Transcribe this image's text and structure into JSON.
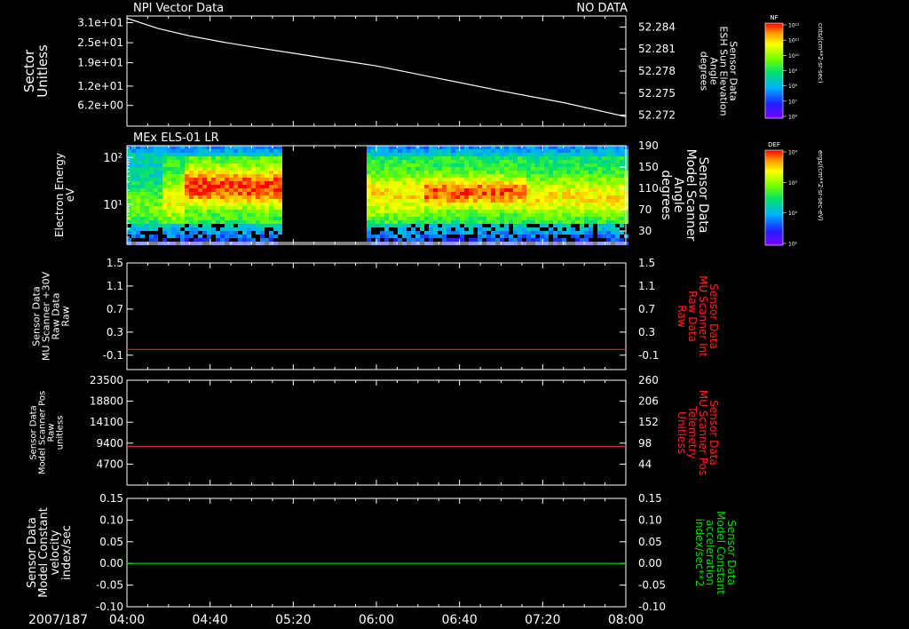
{
  "header": {
    "top_title": "NPI Vector Data",
    "top_status": "NO DATA",
    "panel2_title": "MEx ELS-01 LR"
  },
  "colors": {
    "background": "#000000",
    "axis": "#ffffff",
    "red_trace": "#ff2020",
    "green_trace": "#00dd00"
  },
  "x_axis": {
    "date_label": "2007/187",
    "ticks": [
      "04:00",
      "04:40",
      "05:20",
      "06:00",
      "06:40",
      "07:20",
      "08:00"
    ],
    "range_hours": [
      4.0,
      8.0
    ]
  },
  "colorbars": [
    {
      "name": "NF",
      "unit": "cnts/(cm**2-sr-sec)",
      "tick_labels": [
        "10¹²",
        "10¹¹",
        "10¹⁰",
        "10⁹",
        "10⁸",
        "10⁷",
        "10⁶"
      ]
    },
    {
      "name": "DEF",
      "unit": "ergs/(cm**2-sr-sec-eV)",
      "tick_labels": [
        "10⁴",
        "10³",
        "10²",
        "10¹"
      ]
    }
  ],
  "chart_data": [
    {
      "type": "line",
      "left_axis": {
        "label_lines": [
          "Sector",
          "Unitless"
        ],
        "ticks": [
          "3.1e+01",
          "2.5e+01",
          "1.9e+01",
          "1.2e+01",
          "6.2e+00"
        ],
        "tick_values": [
          31,
          25,
          19,
          12,
          6.2
        ],
        "range": [
          0,
          33
        ]
      },
      "right_axis": {
        "label_lines": [
          "Sensor Data",
          "ESH Sun Elevation",
          "Angle",
          "degrees"
        ],
        "ticks": [
          "52.284",
          "52.281",
          "52.278",
          "52.275",
          "52.272"
        ],
        "tick_values": [
          52.284,
          52.281,
          52.278,
          52.275,
          52.272
        ],
        "range": [
          52.2705,
          52.2855
        ]
      },
      "series": [
        {
          "axis": "right",
          "color": "#ffffff",
          "x": [
            4.0,
            4.25,
            4.5,
            4.75,
            5.0,
            5.5,
            6.0,
            6.5,
            7.0,
            7.5,
            8.0
          ],
          "y": [
            52.2852,
            52.2838,
            52.2828,
            52.282,
            52.2813,
            52.28,
            52.2787,
            52.277,
            52.2753,
            52.2737,
            52.2718
          ]
        }
      ]
    },
    {
      "type": "heatmap",
      "left_axis": {
        "label_lines": [
          "Electron Energy",
          "eV"
        ],
        "ticks": [
          "10²",
          "10¹"
        ],
        "log_range": [
          0.15,
          2.25
        ],
        "tick_log": [
          2,
          1
        ]
      },
      "right_axis": {
        "label_lines": [
          "Sensor Data",
          "Model Scanner",
          "Angle",
          "degrees"
        ],
        "ticks": [
          "190",
          "150",
          "110",
          "70",
          "30"
        ],
        "tick_values": [
          190,
          150,
          110,
          70,
          30
        ],
        "range": [
          5,
          190
        ]
      },
      "data_gap_hours": [
        5.25,
        5.91
      ],
      "angle_trace": {
        "color": "#ffffff",
        "x": [
          4.0,
          5.25,
          5.91,
          8.0
        ],
        "y": [
          5,
          5,
          5,
          5
        ]
      }
    },
    {
      "type": "line",
      "left_axis": {
        "label_lines": [
          "Sensor Data",
          "MU Scanner +30V",
          "Raw Data",
          "Raw"
        ],
        "ticks": [
          "1.5",
          "1.1",
          "0.7",
          "0.3",
          "-0.1"
        ],
        "tick_values": [
          1.5,
          1.1,
          0.7,
          0.3,
          -0.1
        ],
        "range": [
          -0.35,
          1.5
        ]
      },
      "right_axis": {
        "label_lines": [
          "Sensor Data",
          "MU Scanner Int",
          "Raw Data",
          "Raw"
        ],
        "ticks": [
          "1.5",
          "1.1",
          "0.7",
          "0.3",
          "-0.1"
        ],
        "tick_values": [
          1.5,
          1.1,
          0.7,
          0.3,
          -0.1
        ],
        "range": [
          -0.35,
          1.5
        ]
      },
      "series": [
        {
          "axis": "left",
          "color": "#ff2020",
          "x": [
            4.0,
            8.0
          ],
          "y": [
            0.0,
            0.0
          ]
        }
      ]
    },
    {
      "type": "line",
      "left_axis": {
        "label_lines": [
          "Sensor Data",
          "Model Scanner Pos",
          "Raw",
          "unitless"
        ],
        "ticks": [
          "23500",
          "18800",
          "14100",
          "9400",
          "4700"
        ],
        "tick_values": [
          23500,
          18800,
          14100,
          9400,
          4700
        ],
        "range": [
          0,
          23500
        ]
      },
      "right_axis": {
        "label_lines": [
          "Sensor Data",
          "MU Scanner Pos",
          "Telemetry",
          "Unitless"
        ],
        "ticks": [
          "260",
          "206",
          "152",
          "98",
          "44"
        ],
        "tick_values": [
          260,
          206,
          152,
          98,
          44
        ],
        "range": [
          -10,
          260
        ]
      },
      "series": [
        {
          "axis": "left",
          "color": "#ff2020",
          "x": [
            4.0,
            8.0
          ],
          "y": [
            8700,
            8700
          ]
        }
      ]
    },
    {
      "type": "line",
      "left_axis": {
        "label_lines": [
          "Sensor Data",
          "Model Constant",
          "velocity",
          "index/sec"
        ],
        "ticks": [
          "0.15",
          "0.10",
          "0.05",
          "0.00",
          "-0.05",
          "-0.10"
        ],
        "tick_values": [
          0.15,
          0.1,
          0.05,
          0.0,
          -0.05,
          -0.1
        ],
        "range": [
          -0.1,
          0.15
        ]
      },
      "right_axis": {
        "label_lines": [
          "Sensor Data",
          "Model Constant",
          "acceleration",
          "index/sec**2"
        ],
        "ticks": [
          "0.15",
          "0.10",
          "0.05",
          "0.00",
          "-0.05",
          "-0.10"
        ],
        "tick_values": [
          0.15,
          0.1,
          0.05,
          0.0,
          -0.05,
          -0.1
        ],
        "range": [
          -0.1,
          0.15
        ]
      },
      "series": [
        {
          "axis": "left",
          "color": "#00dd00",
          "x": [
            4.0,
            8.0
          ],
          "y": [
            0.0,
            0.0
          ]
        }
      ]
    }
  ]
}
